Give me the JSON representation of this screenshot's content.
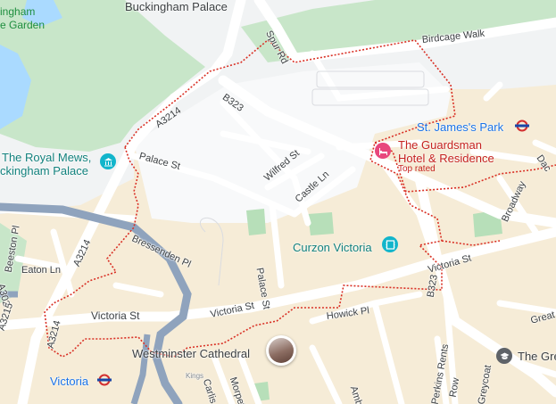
{
  "map": {
    "landmarks": {
      "buckingham_palace": "Buckingham Palace",
      "palace_garden_1": "ingham",
      "palace_garden_2": "e Garden",
      "royal_mews_1": "The Royal Mews,",
      "royal_mews_2": "ckingham Palace",
      "guardsman_1": "The Guardsman",
      "guardsman_2": "Hotel & Residence",
      "guardsman_badge": "Top rated",
      "curzon": "Curzon Victoria",
      "westminster_cathedral": "Westminster Cathedral",
      "st_james_park": "St. James's Park",
      "victoria_station": "Victoria",
      "the_gre": "The Gre"
    },
    "roads": {
      "birdcage_walk": "Birdcage Walk",
      "spur_rd": "Spur Rd",
      "a3214_top": "A3214",
      "a3214_left": "A3214",
      "a3214_bottom": "A3214",
      "b323_top": "B323",
      "b323_right": "B323",
      "palace_st_top": "Palace St",
      "palace_st_mid": "Palace St",
      "wilfred_st": "Wilfred St",
      "castle_ln": "Castle Ln",
      "bressenden_pl": "Bressenden Pl",
      "victoria_st_left": "Victoria St",
      "victoria_st_mid": "Victoria St",
      "victoria_st_right": "Victoria St",
      "howick_pl": "Howick Pl",
      "eaton_ln": "Eaton Ln",
      "beeston_pl": "Beeston Pl",
      "a3215": "A3215",
      "a302": "A302",
      "broadway": "Broadway",
      "dac": "Dac",
      "greycoat": "Greycoat",
      "great": "Great",
      "carlisle": "Carlis",
      "morpeth": "Morpet",
      "ambrosden": "Ambr",
      "perkins": "Perkins Rents",
      "kings": "Kings",
      "row": "Row",
      "rt": "rt"
    },
    "icons": {
      "hotel": "hotel-icon",
      "museum": "museum-icon",
      "cinema": "cinema-icon",
      "underground_1": "underground-icon",
      "underground_2": "underground-icon",
      "school": "school-icon",
      "photo": "photo-marker-icon"
    },
    "colors": {
      "park": "#c8e6c9",
      "water": "#aadaff",
      "built_area": "#f6ecd7",
      "road": "#ffffff",
      "main_road": "#8fa3bd",
      "boundary": "#d93025",
      "hotel_pin": "#e8477c",
      "attraction_pin": "#12b5cb",
      "underground": "#d32f2f"
    }
  }
}
